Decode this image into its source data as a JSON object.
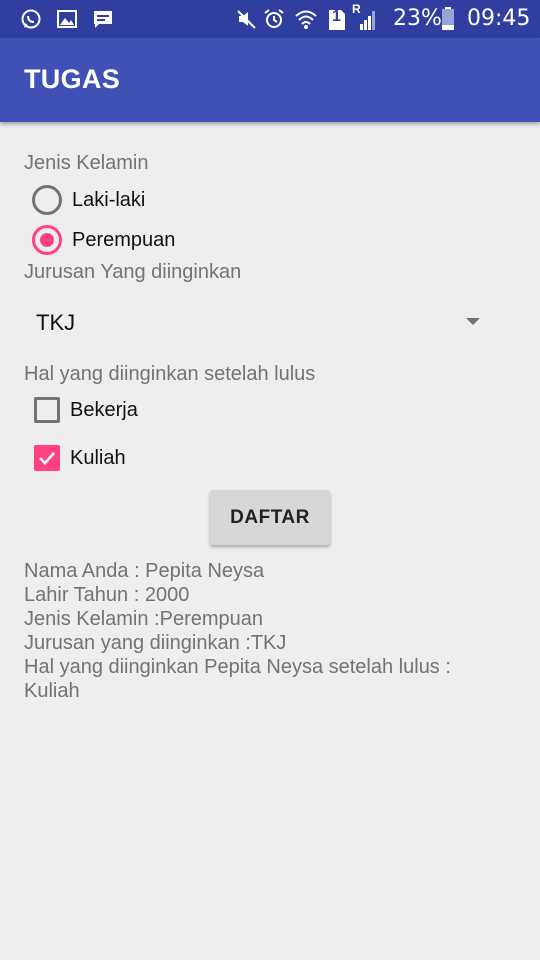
{
  "status_bar": {
    "left_icons": [
      "whatsapp-icon",
      "gallery-icon",
      "messages-icon"
    ],
    "right_icons": [
      "mute-icon",
      "alarm-icon",
      "wifi-icon",
      "sim-icon",
      "signal-icon"
    ],
    "sim_number": "1",
    "roaming": "R",
    "battery_percent": "23%",
    "time": "09:45"
  },
  "app_bar": {
    "title": "TUGAS"
  },
  "form": {
    "gender_label": "Jenis Kelamin",
    "gender_options": [
      "Laki-laki",
      "Perempuan"
    ],
    "gender_selected": "Perempuan",
    "major_label": "Jurusan Yang diinginkan",
    "major_selected": "TKJ",
    "after_label": "Hal yang diinginkan setelah lulus",
    "after_options": [
      {
        "label": "Bekerja",
        "checked": false
      },
      {
        "label": "Kuliah",
        "checked": true
      }
    ],
    "submit_label": "DAFTAR"
  },
  "result": {
    "lines": [
      "Nama Anda : Pepita Neysa",
      "Lahir Tahun : 2000",
      "Jenis Kelamin :Perempuan",
      "Jurusan yang diinginkan :TKJ",
      "Hal yang diinginkan Pepita Neysa setelah lulus :",
      "Kuliah"
    ]
  },
  "colors": {
    "status_bar": "#303f9f",
    "app_bar": "#3f51b5",
    "accent": "#ff4081",
    "background": "#eeeeee"
  }
}
